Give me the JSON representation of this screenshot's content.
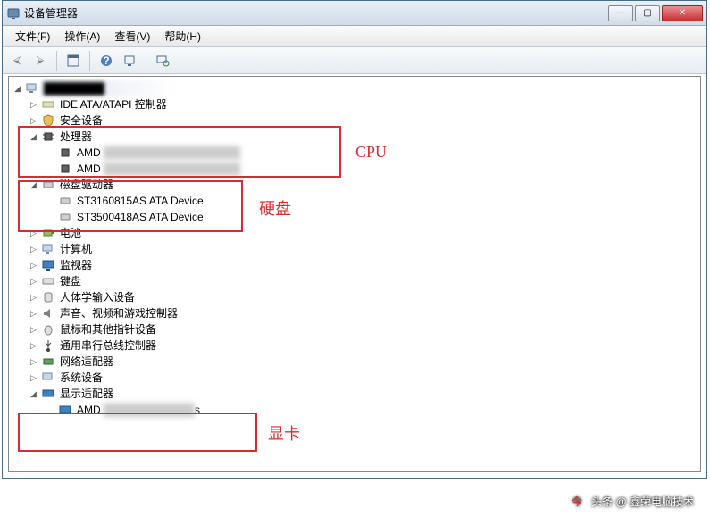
{
  "window": {
    "title": "设备管理器"
  },
  "menus": [
    "文件(F)",
    "操作(A)",
    "查看(V)",
    "帮助(H)"
  ],
  "winbtns": {
    "min": "—",
    "max": "▢",
    "close": "✕"
  },
  "tree": {
    "root": "",
    "ide": "IDE ATA/ATAPI 控制器",
    "security": "安全设备",
    "cpu": "处理器",
    "cpu_items": [
      "AMD",
      "AMD"
    ],
    "disk": "磁盘驱动器",
    "disk_items": [
      "ST3160815AS ATA Device",
      "ST3500418AS ATA Device"
    ],
    "battery": "电池",
    "computer": "计算机",
    "monitor": "监视器",
    "keyboard": "键盘",
    "hid": "人体学输入设备",
    "sound": "声音、视频和游戏控制器",
    "mouse": "鼠标和其他指针设备",
    "usb": "通用串行总线控制器",
    "network": "网络适配器",
    "system": "系统设备",
    "display": "显示适配器",
    "display_items": [
      "AMD"
    ]
  },
  "annotations": {
    "cpu": "CPU",
    "disk": "硬盘",
    "gpu": "显卡"
  },
  "watermark": "头条 @ 鑫荣电脑技术"
}
